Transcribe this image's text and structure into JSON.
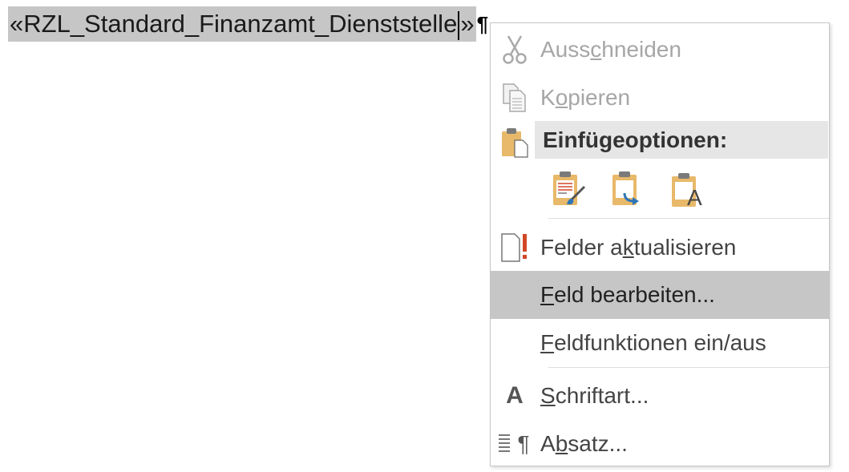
{
  "document": {
    "field_open": "«",
    "field_name": "RZL_Standard_Finanzamt_Dienststelle",
    "field_close": "»",
    "pilcrow": "¶"
  },
  "context_menu": {
    "items": [
      {
        "pre": "Auss",
        "mnemonic": "c",
        "post": "hneiden",
        "icon": "scissors-icon",
        "enabled": false
      },
      {
        "pre": "K",
        "mnemonic": "o",
        "post": "pieren",
        "icon": "copy-icon",
        "enabled": false
      }
    ],
    "paste_options": {
      "header": "Einfügeoptionen:",
      "icon": "clipboard-icon",
      "buttons": [
        {
          "name": "keep-source-formatting",
          "icon": "clipboard-brush-icon"
        },
        {
          "name": "merge-formatting",
          "icon": "clipboard-arrow-icon"
        },
        {
          "name": "keep-text-only",
          "icon": "clipboard-text-icon",
          "glyph": "A"
        }
      ]
    },
    "field_items": [
      {
        "pre": "Felder a",
        "mnemonic": "k",
        "post": "tualisieren",
        "icon": "update-fields-icon"
      },
      {
        "pre": "",
        "mnemonic": "F",
        "post": "eld bearbeiten...",
        "selected": true
      },
      {
        "pre": "",
        "mnemonic": "F",
        "post": "eldfunktionen ein/aus"
      }
    ],
    "format_items": [
      {
        "pre": "",
        "mnemonic": "S",
        "post": "chriftart...",
        "icon": "font-icon",
        "glyph": "A"
      },
      {
        "pre": "A",
        "mnemonic": "b",
        "post": "satz...",
        "icon": "paragraph-icon",
        "glyph": "¶"
      }
    ]
  },
  "colors": {
    "selection_highlight": "#c6c6c6",
    "menu_hover": "#c6c6c6",
    "section_header_bg": "#e6e6e6",
    "disabled_text": "#a6a6a6",
    "clipboard_gold": "#e8b96a",
    "accent_red": "#d24726",
    "accent_blue": "#2e75b6"
  }
}
